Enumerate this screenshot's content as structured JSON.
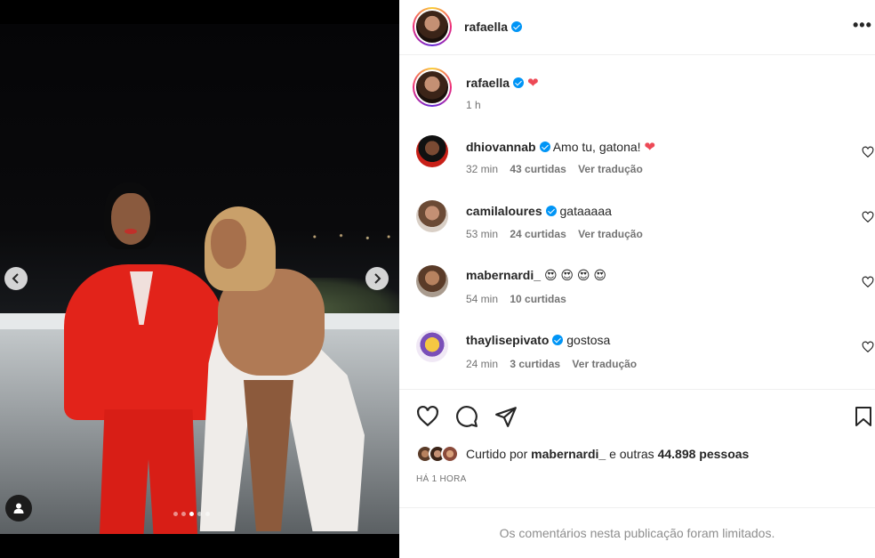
{
  "post": {
    "author": "rafaella",
    "more_icon": "more-horizontal-icon",
    "carousel": {
      "slide_count": 5,
      "active_slide": 3
    }
  },
  "caption": {
    "username": "rafaella",
    "text": "❤",
    "time": "1 h"
  },
  "comments": [
    {
      "username": "dhiovannab",
      "verified": true,
      "text": "Amo tu, gatona!",
      "emoji": "❤",
      "time": "32 min",
      "likes": "43 curtidas",
      "translate": "Ver tradução"
    },
    {
      "username": "camilaloures",
      "verified": true,
      "text": "gataaaaa",
      "emoji": "",
      "time": "53 min",
      "likes": "24 curtidas",
      "translate": "Ver tradução"
    },
    {
      "username": "mabernardi_",
      "verified": false,
      "text": "😍 😍 😍 😍",
      "emoji": "",
      "time": "54 min",
      "likes": "10 curtidas",
      "translate": ""
    },
    {
      "username": "thaylisepivato",
      "verified": true,
      "text": "gostosa",
      "emoji": "",
      "time": "24 min",
      "likes": "3 curtidas",
      "translate": "Ver tradução"
    }
  ],
  "likes": {
    "prefix": "Curtido por",
    "user": "mabernardi_",
    "suffix": "e outras",
    "count": "44.898 pessoas"
  },
  "timestamp": "HÁ 1 HORA",
  "comments_limited": "Os comentários nesta publicação foram limitados.",
  "colors": {
    "verified": "#0095f6",
    "heart": "#ed4956",
    "muted": "#737373"
  }
}
